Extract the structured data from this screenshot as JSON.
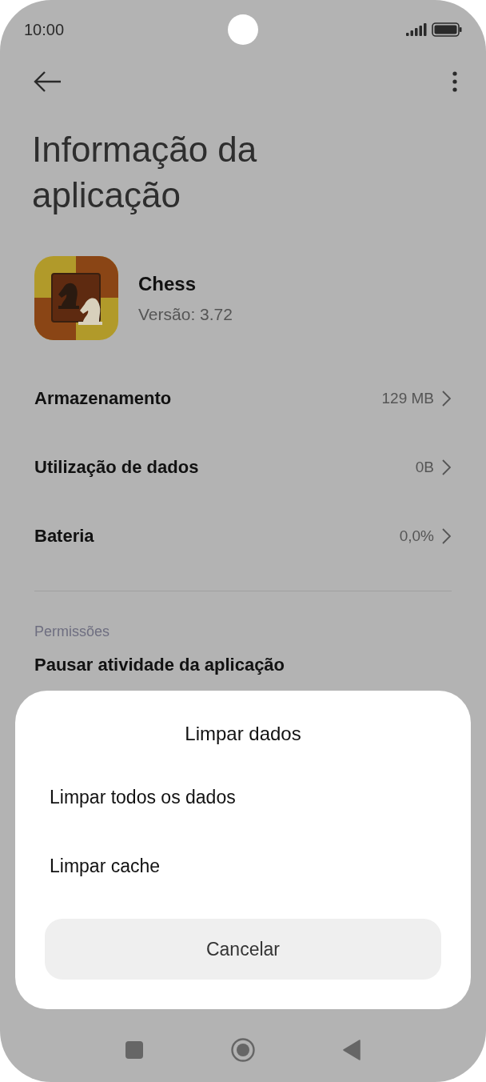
{
  "status_bar": {
    "time": "10:00"
  },
  "title": "Informação da aplicação",
  "app": {
    "name": "Chess",
    "version": "Versão: 3.72"
  },
  "rows": [
    {
      "label": "Armazenamento",
      "value": "129 MB"
    },
    {
      "label": "Utilização de dados",
      "value": "0B"
    },
    {
      "label": "Bateria",
      "value": "0,0%"
    }
  ],
  "section": {
    "header": "Permissões",
    "first_item": "Pausar atividade da aplicação"
  },
  "dialog": {
    "title": "Limpar dados",
    "options": [
      "Limpar todos os dados",
      "Limpar cache"
    ],
    "cancel": "Cancelar"
  }
}
